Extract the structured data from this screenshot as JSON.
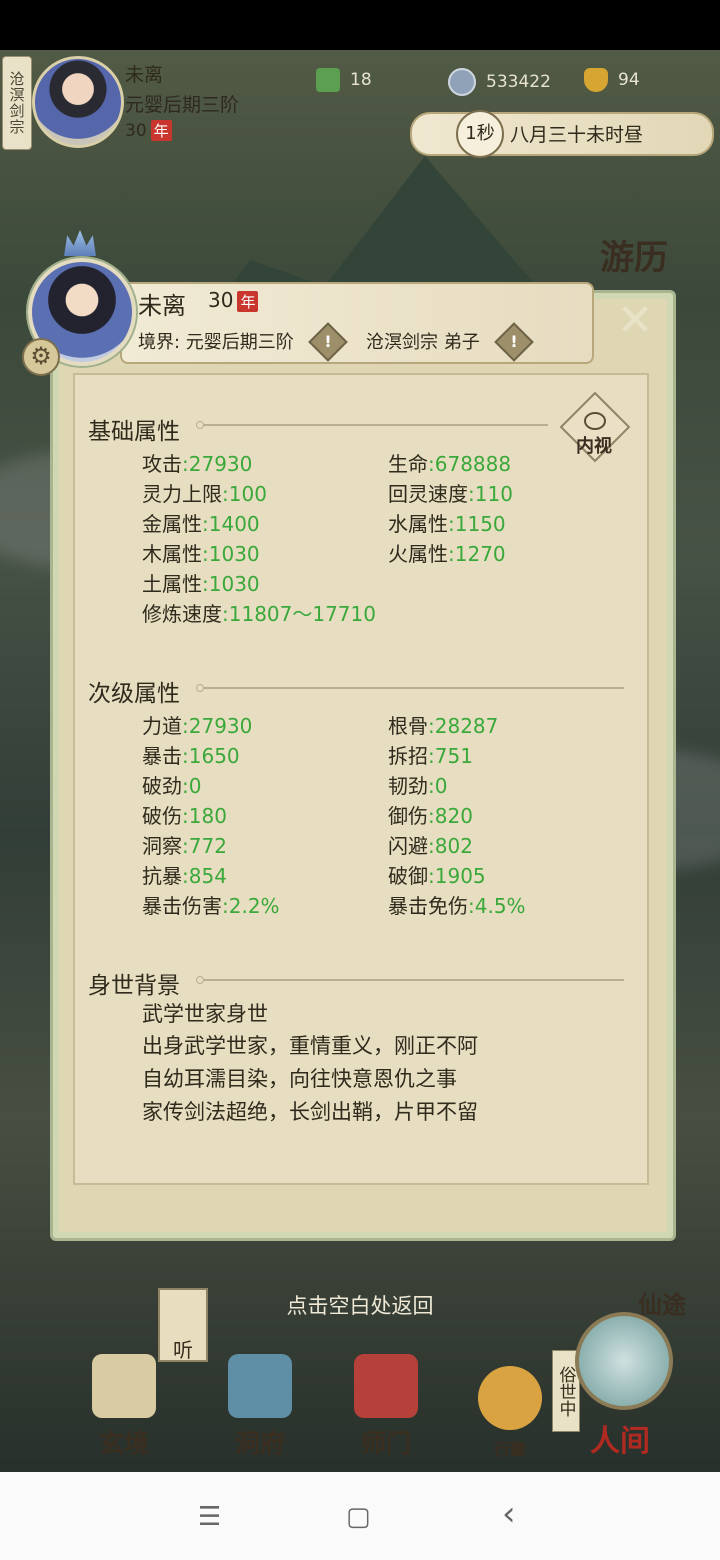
{
  "topbar": {
    "sect": "沧溟剑宗",
    "name": "未离",
    "realm": "元婴后期三阶",
    "age": "30",
    "nian": "年",
    "res1": "18",
    "res2": "533422",
    "res3": "94",
    "time_icon": "1秒",
    "time_text": "八月三十未时昼"
  },
  "side": {
    "you_label": "游历"
  },
  "profile": {
    "name": "未离",
    "age": "30",
    "nian": "年",
    "realm": "境界: 元婴后期三阶",
    "sect": "沧溟剑宗 弟子",
    "warn": "!",
    "close": "✕",
    "eye_label": "内视"
  },
  "basic": {
    "title": "基础属性",
    "items": [
      {
        "k": "攻击",
        "v": ":27930"
      },
      {
        "k": "生命",
        "v": ":678888"
      },
      {
        "k": "灵力上限",
        "v": ":100"
      },
      {
        "k": "回灵速度",
        "v": ":110"
      },
      {
        "k": "金属性",
        "v": ":1400"
      },
      {
        "k": "水属性",
        "v": ":1150"
      },
      {
        "k": "木属性",
        "v": ":1030"
      },
      {
        "k": "火属性",
        "v": ":1270"
      },
      {
        "k": "土属性",
        "v": ":1030"
      },
      {
        "k": "修炼速度",
        "v": ":11807～17710"
      }
    ]
  },
  "secondary": {
    "title": "次级属性",
    "items": [
      {
        "k": "力道",
        "v": ":27930"
      },
      {
        "k": "根骨",
        "v": ":28287"
      },
      {
        "k": "暴击",
        "v": ":1650"
      },
      {
        "k": "拆招",
        "v": ":751"
      },
      {
        "k": "破劲",
        "v": ":0"
      },
      {
        "k": "韧劲",
        "v": ":0"
      },
      {
        "k": "破伤",
        "v": ":180"
      },
      {
        "k": "御伤",
        "v": ":820"
      },
      {
        "k": "洞察",
        "v": ":772"
      },
      {
        "k": "闪避",
        "v": ":802"
      },
      {
        "k": "抗暴",
        "v": ":854"
      },
      {
        "k": "破御",
        "v": ":1905"
      },
      {
        "k": "暴击伤害",
        "v": ":2.2%"
      },
      {
        "k": "暴击免伤",
        "v": ":4.5%"
      }
    ]
  },
  "background": {
    "title": "身世背景",
    "lines": [
      "武学世家身世",
      "出身武学世家，重情重义，刚正不阿",
      "自幼耳濡目染，向往快意恩仇之事",
      "家传剑法超绝，长剑出鞘，片甲不留"
    ]
  },
  "return_hint": "点击空白处返回",
  "bottom_nav": {
    "ting": "听",
    "xian": "仙途",
    "items": [
      "玄境",
      "洞府",
      "师门",
      "行囊",
      "人间"
    ],
    "sushi": "俗世中"
  },
  "android": {
    "menu": "☰",
    "home": "▢",
    "back": "‹"
  }
}
